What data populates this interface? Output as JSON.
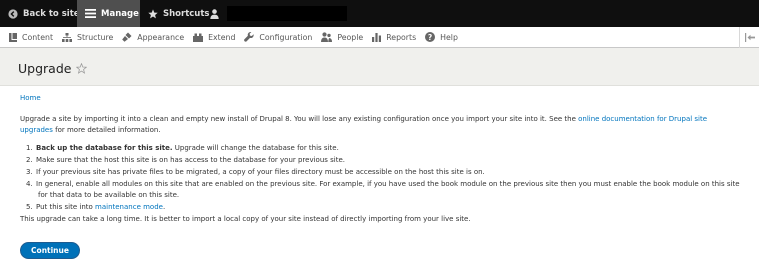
{
  "toolbar": {
    "back_label": "Back to site",
    "manage_label": "Manage",
    "shortcuts_label": "Shortcuts"
  },
  "tray": {
    "items": [
      {
        "label": "Content",
        "icon": "content-icon"
      },
      {
        "label": "Structure",
        "icon": "structure-icon"
      },
      {
        "label": "Appearance",
        "icon": "appearance-icon"
      },
      {
        "label": "Extend",
        "icon": "extend-icon"
      },
      {
        "label": "Configuration",
        "icon": "wrench-icon"
      },
      {
        "label": "People",
        "icon": "people-icon"
      },
      {
        "label": "Reports",
        "icon": "reports-icon"
      },
      {
        "label": "Help",
        "icon": "help-icon"
      }
    ]
  },
  "page": {
    "title": "Upgrade",
    "breadcrumb": "Home"
  },
  "intro": {
    "text": "Upgrade a site by importing it into a clean and empty new install of Drupal 8. You will lose any existing configuration once you import your site into it. See the ",
    "link": "online documentation for Drupal site upgrades",
    "suffix": " for more detailed information."
  },
  "steps": [
    {
      "num": "1.",
      "bold": "Back up the database for this site.",
      "text": " Upgrade will change the database for this site."
    },
    {
      "num": "2.",
      "text": "Make sure that the host this site is on has access to the database for your previous site."
    },
    {
      "num": "3.",
      "text": "If your previous site has private files to be migrated, a copy of your files directory must be accessible on the host this site is on."
    },
    {
      "num": "4.",
      "text": "In general, enable all modules on this site that are enabled on the previous site. For example, if you have used the book module on the previous site then you must enable the book module on this site for that data to be available on this site."
    },
    {
      "num": "5.",
      "text": "Put this site into ",
      "link": "maintenance mode",
      "suffix": "."
    }
  ],
  "note": "This upgrade can take a long time. It is better to import a local copy of your site instead of directly importing from your live site.",
  "continue_label": "Continue",
  "colors": {
    "toolbar_bg": "#0f0f0f",
    "accent": "#0074bd",
    "button": "#0071b8",
    "header_bg": "#f0f0ed"
  }
}
